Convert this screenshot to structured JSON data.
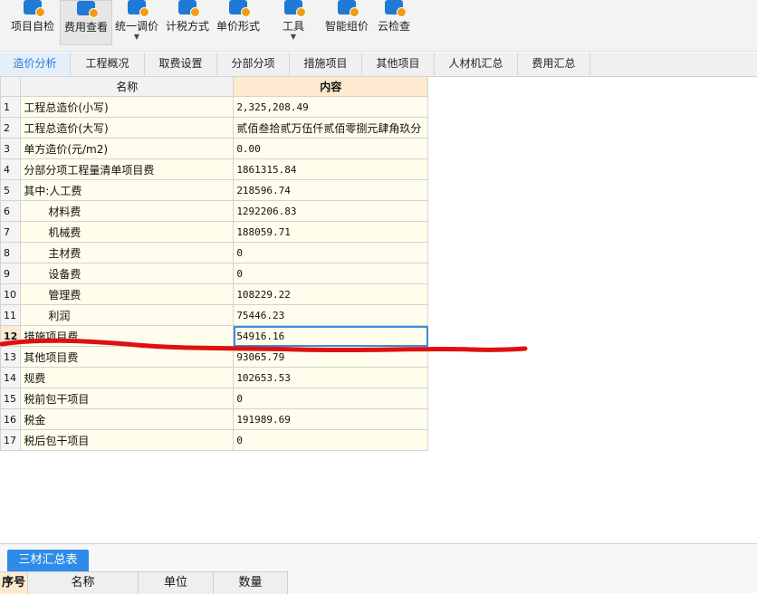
{
  "toolbar": {
    "buttons": [
      {
        "label": "项目自检",
        "icon": "check-doc-icon"
      },
      {
        "label": "费用查看",
        "icon": "fee-view-icon"
      },
      {
        "label": "统一调价",
        "icon": "adjust-price-icon",
        "dropdown": true
      },
      {
        "label": "计税方式",
        "icon": "tax-method-icon"
      },
      {
        "label": "单价形式",
        "icon": "unit-price-icon"
      },
      {
        "label": "工具",
        "icon": "tool-icon",
        "dropdown": true
      },
      {
        "label": "智能组价",
        "icon": "smart-price-icon"
      },
      {
        "label": "云检查",
        "icon": "cloud-check-icon"
      }
    ]
  },
  "tabs": [
    "造价分析",
    "工程概况",
    "取费设置",
    "分部分项",
    "措施项目",
    "其他项目",
    "人材机汇总",
    "费用汇总"
  ],
  "grid": {
    "headers": {
      "name": "名称",
      "value": "内容"
    },
    "rows": [
      {
        "no": "1",
        "name": "工程总造价(小写)",
        "value": "2,325,208.49"
      },
      {
        "no": "2",
        "name": "工程总造价(大写)",
        "value": "贰佰叁拾贰万伍仟贰佰零捌元肆角玖分"
      },
      {
        "no": "3",
        "name": "单方造价(元/m2)",
        "value": "0.00"
      },
      {
        "no": "4",
        "name": "分部分项工程量清单项目费",
        "value": "1861315.84"
      },
      {
        "no": "5",
        "name": "其中:人工费",
        "value": "218596.74"
      },
      {
        "no": "6",
        "name": "材料费",
        "value": "1292206.83"
      },
      {
        "no": "7",
        "name": "机械费",
        "value": "188059.71"
      },
      {
        "no": "8",
        "name": "主材费",
        "value": "0"
      },
      {
        "no": "9",
        "name": "设备费",
        "value": "0"
      },
      {
        "no": "10",
        "name": "管理费",
        "value": "108229.22"
      },
      {
        "no": "11",
        "name": "利润",
        "value": "75446.23"
      },
      {
        "no": "12",
        "name": "措施项目费",
        "value": "54916.16"
      },
      {
        "no": "13",
        "name": "其他项目费",
        "value": "93065.79"
      },
      {
        "no": "14",
        "name": "规费",
        "value": "102653.53"
      },
      {
        "no": "15",
        "name": "税前包干项目",
        "value": "0"
      },
      {
        "no": "16",
        "name": "税金",
        "value": "191989.69"
      },
      {
        "no": "17",
        "name": "税后包干项目",
        "value": "0"
      }
    ]
  },
  "bottom": {
    "tab": "三材汇总表",
    "columns": [
      "序号",
      "名称",
      "单位",
      "数量"
    ]
  },
  "colors": {
    "accent": "#2f8be8",
    "highlight": "#fde9cf",
    "cell_bg": "#fffdec",
    "annotation": "#e01010"
  }
}
